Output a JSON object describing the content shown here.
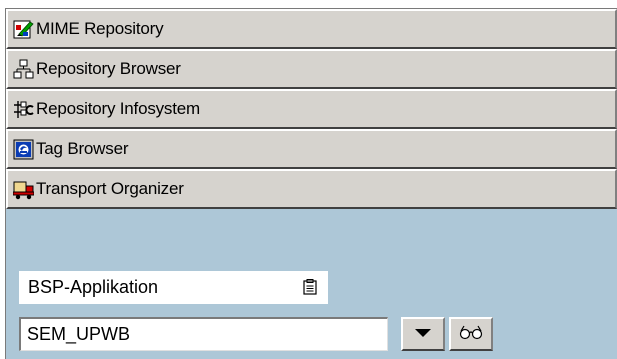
{
  "navigation": {
    "items": [
      {
        "label": "MIME Repository",
        "icon": "mime-repository-icon"
      },
      {
        "label": "Repository Browser",
        "icon": "repository-browser-icon"
      },
      {
        "label": "Repository Infosystem",
        "icon": "repository-infosystem-icon"
      },
      {
        "label": "Tag Browser",
        "icon": "tag-browser-icon"
      },
      {
        "label": "Transport Organizer",
        "icon": "transport-organizer-icon"
      }
    ]
  },
  "object_selector": {
    "type_label": "BSP-Applikation",
    "type_icon": "clipboard-icon",
    "name_value": "SEM_UPWB",
    "dropdown_icon": "triangle-down-icon",
    "display_icon": "glasses-icon"
  },
  "colors": {
    "panel_background": "#adc7d7",
    "button_face": "#d6d3ce"
  }
}
